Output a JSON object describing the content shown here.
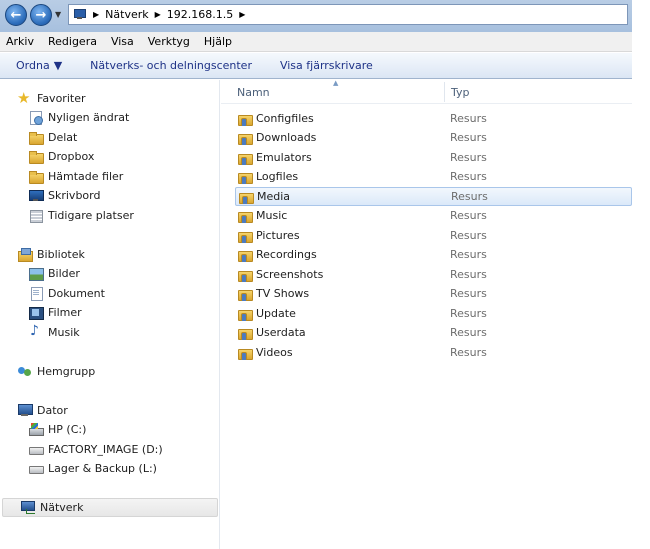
{
  "address": {
    "crumbs": [
      "Nätverk",
      "192.168.1.5"
    ]
  },
  "menu": [
    "Arkiv",
    "Redigera",
    "Visa",
    "Verktyg",
    "Hjälp"
  ],
  "commands": {
    "organize": "Ordna",
    "network_center": "Nätverks- och delningscenter",
    "printers": "Visa fjärrskrivare"
  },
  "nav": {
    "favorites": {
      "label": "Favoriter",
      "items": [
        "Nyligen ändrat",
        "Delat",
        "Dropbox",
        "Hämtade filer",
        "Skrivbord",
        "Tidigare platser"
      ]
    },
    "libraries": {
      "label": "Bibliotek",
      "items": [
        "Bilder",
        "Dokument",
        "Filmer",
        "Musik"
      ]
    },
    "homegroup": {
      "label": "Hemgrupp"
    },
    "computer": {
      "label": "Dator",
      "items": [
        "HP (C:)",
        "FACTORY_IMAGE (D:)",
        "Lager & Backup (L:)"
      ]
    },
    "network": {
      "label": "Nätverk"
    }
  },
  "columns": {
    "name": "Namn",
    "type": "Typ"
  },
  "files": [
    {
      "name": "Configfiles",
      "type": "Resurs"
    },
    {
      "name": "Downloads",
      "type": "Resurs"
    },
    {
      "name": "Emulators",
      "type": "Resurs"
    },
    {
      "name": "Logfiles",
      "type": "Resurs"
    },
    {
      "name": "Media",
      "type": "Resurs"
    },
    {
      "name": "Music",
      "type": "Resurs"
    },
    {
      "name": "Pictures",
      "type": "Resurs"
    },
    {
      "name": "Recordings",
      "type": "Resurs"
    },
    {
      "name": "Screenshots",
      "type": "Resurs"
    },
    {
      "name": "TV Shows",
      "type": "Resurs"
    },
    {
      "name": "Update",
      "type": "Resurs"
    },
    {
      "name": "Userdata",
      "type": "Resurs"
    },
    {
      "name": "Videos",
      "type": "Resurs"
    }
  ]
}
